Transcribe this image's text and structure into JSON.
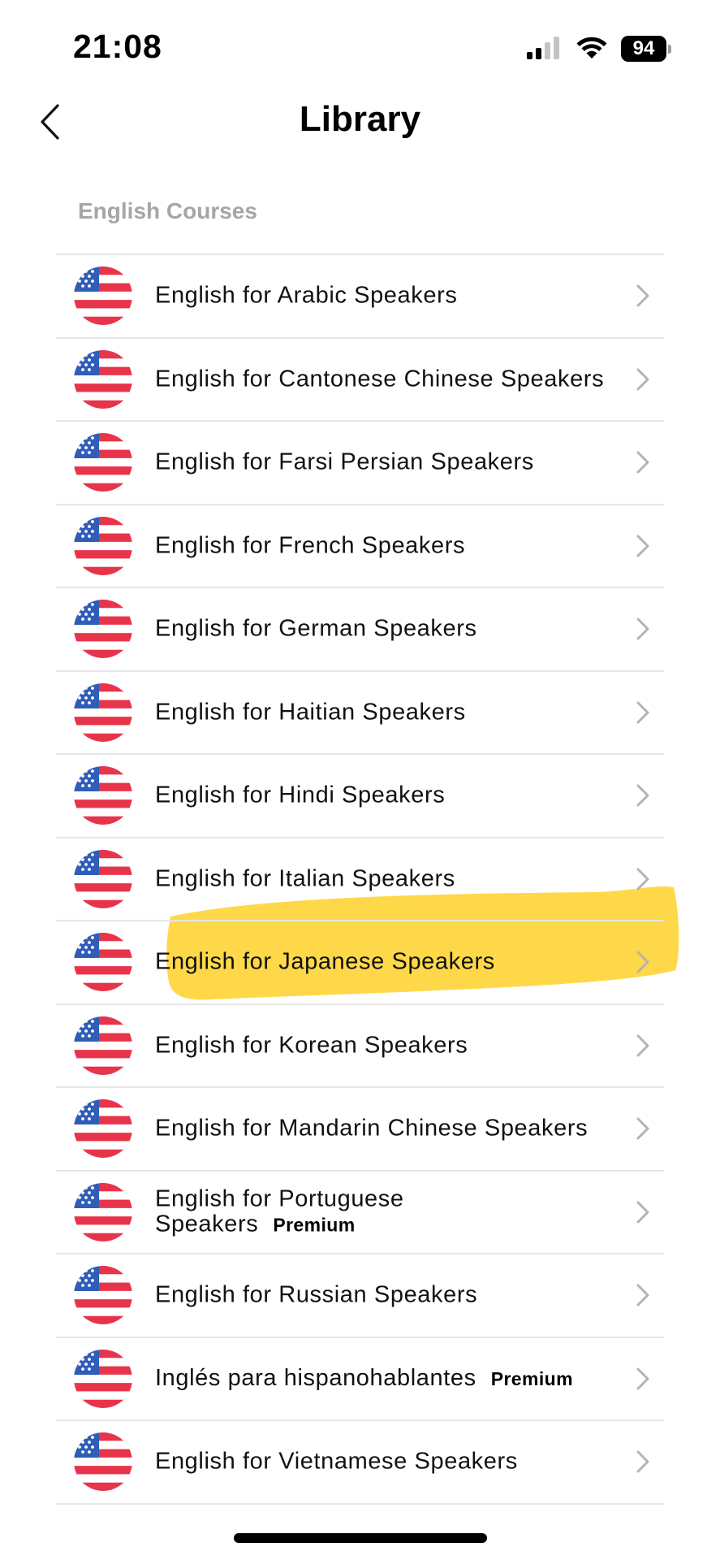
{
  "status_bar": {
    "time": "21:08",
    "battery": "94"
  },
  "header": {
    "title": "Library"
  },
  "section": {
    "title": "English Courses"
  },
  "courses": [
    {
      "label": "English for Arabic Speakers",
      "premium": ""
    },
    {
      "label": "English for Cantonese Chinese Speakers",
      "premium": ""
    },
    {
      "label": "English for Farsi Persian Speakers",
      "premium": ""
    },
    {
      "label": "English for French Speakers",
      "premium": ""
    },
    {
      "label": "English for German Speakers",
      "premium": ""
    },
    {
      "label": "English for Haitian Speakers",
      "premium": ""
    },
    {
      "label": "English for Hindi Speakers",
      "premium": ""
    },
    {
      "label": "English for Italian Speakers",
      "premium": ""
    },
    {
      "label": "English for Japanese Speakers",
      "premium": ""
    },
    {
      "label": "English for Korean Speakers",
      "premium": ""
    },
    {
      "label": "English for Mandarin Chinese Speakers",
      "premium": ""
    },
    {
      "label": "English for Portuguese Speakers",
      "premium": "Premium"
    },
    {
      "label": "English for Russian Speakers",
      "premium": ""
    },
    {
      "label": "Inglés para hispanohablantes",
      "premium": "Premium"
    },
    {
      "label": "English for Vietnamese Speakers",
      "premium": ""
    }
  ],
  "icons": {
    "back": "chevron-left-icon",
    "row_flag": "us-flag-icon",
    "row_chevron": "chevron-right-icon"
  },
  "colors": {
    "flag_red": "#E8344A",
    "flag_blue": "#2F5DB8",
    "highlight": "#FFD53A",
    "divider": "#E6E6E6",
    "section_title": "#A6A6A6",
    "chevron": "#B3B3B3"
  }
}
